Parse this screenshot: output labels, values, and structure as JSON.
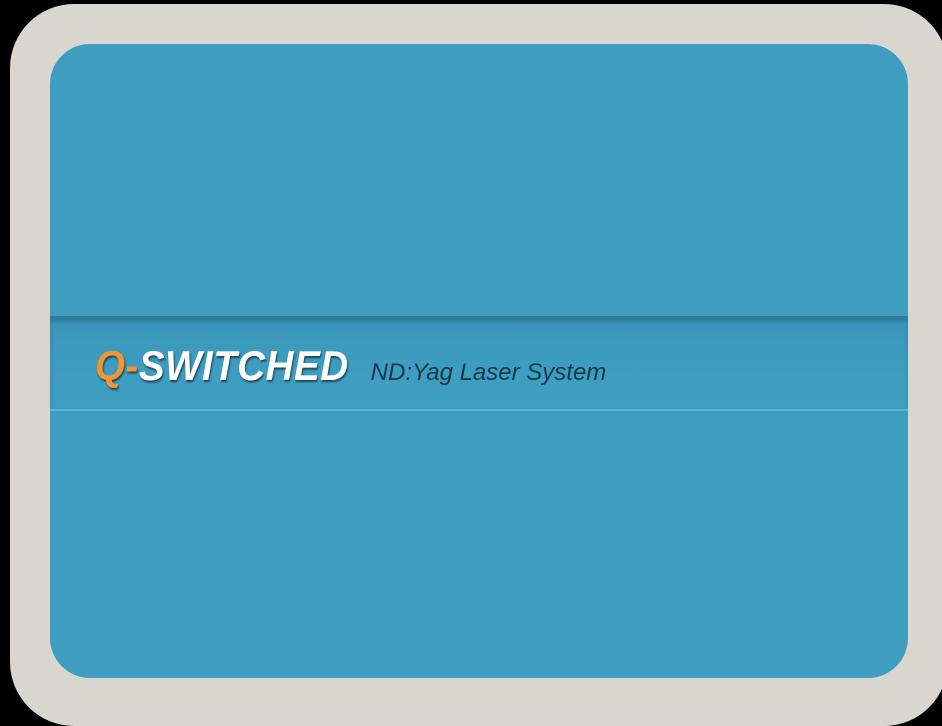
{
  "splash": {
    "brand_accent": "Q-",
    "brand_main": "SWITCHED",
    "subtitle": "ND:Yag Laser System"
  },
  "colors": {
    "bezel": "#d9d6d0",
    "screen": "#3f9dbf",
    "brand_accent": "#f39533",
    "brand_main": "#ffffff",
    "subtitle": "#143a49"
  }
}
